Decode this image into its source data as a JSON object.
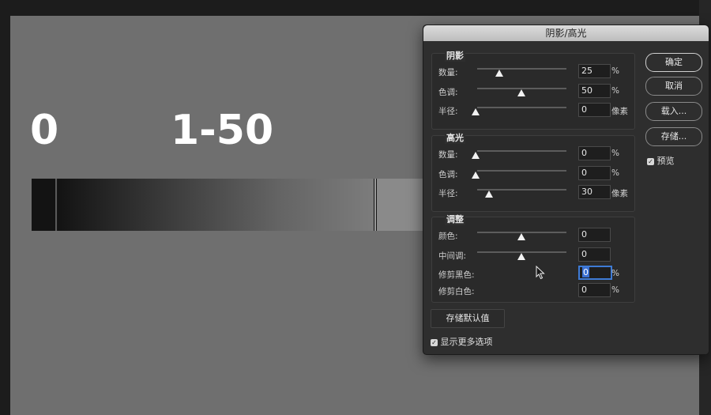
{
  "canvas": {
    "label_zero": "0",
    "label_range": "1-50"
  },
  "dialog": {
    "title": "阴影/高光",
    "shadows": {
      "title": "阴影",
      "rows": [
        {
          "label": "数量:",
          "value": "25",
          "unit": "%",
          "fraction": 0.25
        },
        {
          "label": "色调:",
          "value": "50",
          "unit": "%",
          "fraction": 0.5
        },
        {
          "label": "半径:",
          "value": "0",
          "unit": "像素",
          "fraction": 0.0
        }
      ]
    },
    "highlights": {
      "title": "高光",
      "rows": [
        {
          "label": "数量:",
          "value": "0",
          "unit": "%",
          "fraction": 0.0
        },
        {
          "label": "色调:",
          "value": "0",
          "unit": "%",
          "fraction": 0.0
        },
        {
          "label": "半径:",
          "value": "30",
          "unit": "像素",
          "fraction": 0.15
        }
      ]
    },
    "adjustments": {
      "title": "调整",
      "rows": [
        {
          "label": "颜色:",
          "value": "0",
          "unit": "",
          "fraction": 0.5
        },
        {
          "label": "中间调:",
          "value": "0",
          "unit": "",
          "fraction": 0.5
        },
        {
          "label": "修剪黑色:",
          "value": "0",
          "unit": "%"
        },
        {
          "label": "修剪白色:",
          "value": "0",
          "unit": "%"
        }
      ]
    },
    "buttons": {
      "ok": "确定",
      "cancel": "取消",
      "load": "载入...",
      "save": "存储..."
    },
    "preview_label": "预览",
    "save_default_label": "存储默认值",
    "more_options_label": "显示更多选项"
  }
}
